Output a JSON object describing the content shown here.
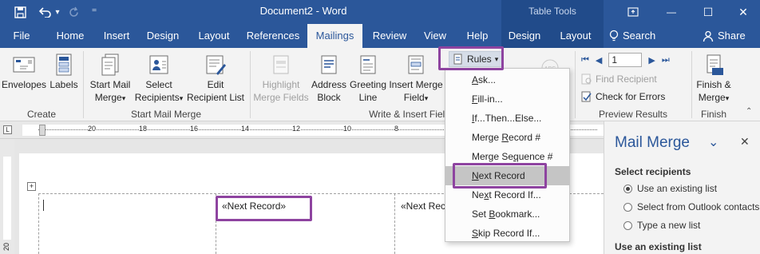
{
  "window": {
    "title": "Document2  -  Word",
    "context_tab": "Table Tools",
    "minimize_glyph": "—",
    "maximize_glyph": "☐",
    "close_glyph": "✕"
  },
  "qat": {
    "undo_dropdown": "▾",
    "customize": "⁼"
  },
  "tabs": [
    {
      "label": "File"
    },
    {
      "label": "Home"
    },
    {
      "label": "Insert"
    },
    {
      "label": "Design"
    },
    {
      "label": "Layout"
    },
    {
      "label": "References"
    },
    {
      "label": "Mailings"
    },
    {
      "label": "Review"
    },
    {
      "label": "View"
    },
    {
      "label": "Help"
    },
    {
      "label": "Design"
    },
    {
      "label": "Layout"
    }
  ],
  "tell_me": "Search",
  "share": "Share",
  "ribbon": {
    "create": {
      "envelopes": "Envelopes",
      "labels": "Labels",
      "group": "Create"
    },
    "start": {
      "start_line1": "Start Mail",
      "start_line2": "Merge",
      "select_line1": "Select",
      "select_line2": "Recipients",
      "edit_line1": "Edit",
      "edit_line2": "Recipient List",
      "group": "Start Mail Merge",
      "dropdown": "▾"
    },
    "write": {
      "highlight_line1": "Highlight",
      "highlight_line2": "Merge Fields",
      "address_line1": "Address",
      "address_line2": "Block",
      "greeting_line1": "Greeting",
      "greeting_line2": "Line",
      "insert_line1": "Insert Merge",
      "insert_line2": "Field",
      "rules": "Rules",
      "group": "Write & Insert Fields"
    },
    "preview": {
      "record_value": "1",
      "find_recipient": "Find Recipient",
      "check_errors": "Check for Errors",
      "group": "Preview Results",
      "first": "⏮",
      "prev": "◀",
      "next": "▶",
      "last": "⏭"
    },
    "finish": {
      "line1": "Finish &",
      "line2": "Merge",
      "group": "Finish"
    }
  },
  "ruler": {
    "labels": [
      "20",
      "18",
      "16",
      "14",
      "12",
      "10",
      "8",
      "6",
      "4",
      "2"
    ],
    "vertical_label": "20"
  },
  "rules_menu": [
    {
      "pre": "",
      "ul": "A",
      "post": "sk..."
    },
    {
      "pre": "",
      "ul": "F",
      "post": "ill-in..."
    },
    {
      "pre": "",
      "ul": "I",
      "post": "f...Then...Else..."
    },
    {
      "pre": "Merge ",
      "ul": "R",
      "post": "ecord #"
    },
    {
      "pre": "Merge Se",
      "ul": "q",
      "post": "uence #"
    },
    {
      "pre": "",
      "ul": "N",
      "post": "ext Record"
    },
    {
      "pre": "Ne",
      "ul": "x",
      "post": "t Record If..."
    },
    {
      "pre": "Set ",
      "ul": "B",
      "post": "ookmark..."
    },
    {
      "pre": "",
      "ul": "S",
      "post": "kip Record If..."
    }
  ],
  "document": {
    "cells": [
      "«Next Record»",
      "«Next Record»"
    ]
  },
  "pane": {
    "title": "Mail Merge",
    "select_heading": "Select recipients",
    "options": [
      "Use an existing list",
      "Select from Outlook contacts",
      "Type a new list"
    ],
    "selected_index": 0,
    "list_heading": "Use an existing list",
    "collapse_glyph": "⌄",
    "close_glyph": "✕"
  },
  "colors": {
    "accent": "#2b579a",
    "highlight_box": "#8e44a0",
    "menu_selection": "#c5c5c5"
  }
}
